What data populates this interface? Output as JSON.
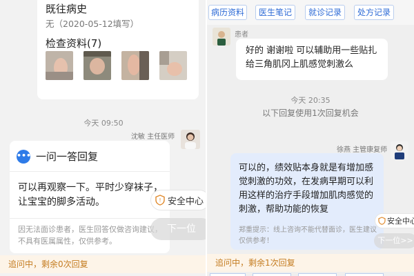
{
  "left": {
    "history_title": "既往病史",
    "history_value": "无（2020-05-12填写）",
    "exam_title": "检查资料(7)",
    "time": "今天 09:50",
    "doctor_name": "沈敏 主任医师",
    "answer_title": "一问一答回复",
    "answer_body": "可以再观察一下。平时少穿袜子，让宝宝的脚多活动。",
    "answer_note": "因无法面诊患者，医生回答仅做咨询建议，不具有医属属性，仅供参考。",
    "safety_label": "安全中心",
    "next_label": "下一位",
    "status": "追问中，剩余0次回复"
  },
  "right": {
    "tabs": [
      "病历资料",
      "医生笔记",
      "就诊记录",
      "处方记录"
    ],
    "patient_label": "患者",
    "patient_msg": "好的 谢谢啦 可以辅助用一些贴扎给三角肌冈上肌感觉刺激么",
    "time": "今天 20:35",
    "sys_note": "以下回复使用1次回复机会",
    "doctor_name": "徐燕 主管康复师",
    "doctor_msg": "可以的，绩效贴本身就是有增加感觉刺激的功效，在发病早期可以利用这样的治疗手段增加肌肉感觉的刺激，帮助功能的恢复",
    "doctor_note": "郑重提示：线上咨询不能代替面诊，医生建议仅供参考！",
    "safety_label": "安全中心",
    "next_label": "下一位>>",
    "status": "追问中，剩余1次回复"
  },
  "colors": {
    "accent_blue": "#2e7be8",
    "status_orange": "#c47b1f",
    "doctor_bubble": "#e3ecfc"
  }
}
